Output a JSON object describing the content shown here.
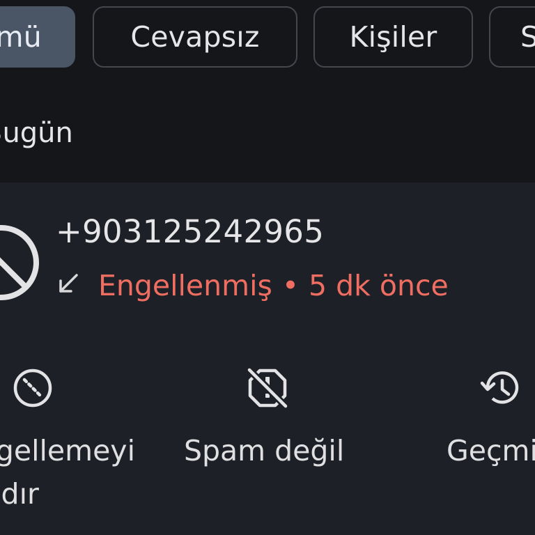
{
  "filter_chips": [
    {
      "label": "Tümü",
      "selected": true
    },
    {
      "label": "Cevapsız",
      "selected": false
    },
    {
      "label": "Kişiler",
      "selected": false
    },
    {
      "label": "Spam",
      "selected": false
    }
  ],
  "section": {
    "label": "Bugün"
  },
  "call": {
    "number": "+903125242965",
    "direction_icon": "incoming-arrow-icon",
    "status": "Engellenmiş",
    "separator": "•",
    "time": "5 dk önce",
    "status_color": "#ef6e61"
  },
  "actions": [
    {
      "label_line1": "Engellemeyi",
      "label_line2": "kaldır",
      "icon": "unblock-icon"
    },
    {
      "label": "Spam değil",
      "icon": "not-spam-icon"
    },
    {
      "label": "Geçmiş",
      "icon": "history-icon"
    }
  ],
  "colors": {
    "background": "#15161a",
    "card": "#1e2027",
    "chip_selected": "#4a5566",
    "chip_border": "#45474d",
    "accent_red": "#ef6e61"
  }
}
